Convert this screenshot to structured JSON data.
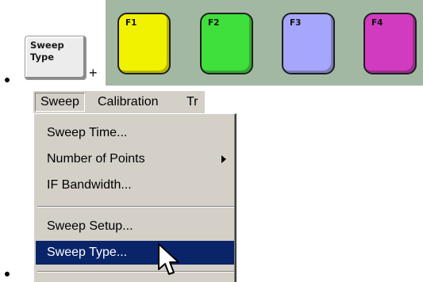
{
  "hardkey": {
    "line1": "Sweep",
    "line2": "Type"
  },
  "plus": "+",
  "fkeys": [
    {
      "label": "F1",
      "color": "#f1f200"
    },
    {
      "label": "F2",
      "color": "#3fe03c"
    },
    {
      "label": "F3",
      "color": "#a6a6fc"
    },
    {
      "label": "F4",
      "color": "#d13bbf"
    }
  ],
  "menubar": {
    "items": [
      "Sweep",
      "Calibration",
      "Tr"
    ]
  },
  "menu": {
    "items": [
      {
        "label": "Sweep Time..."
      },
      {
        "label": "Number of Points",
        "has_submenu": true
      },
      {
        "label": "IF Bandwidth..."
      },
      {
        "label": "Sweep Setup..."
      },
      {
        "label": "Sweep Type...",
        "selected": true
      }
    ],
    "selection_color": "#0a246a"
  },
  "icons": {
    "submenu": "submenu-arrow-icon",
    "cursor": "mouse-pointer-icon"
  }
}
